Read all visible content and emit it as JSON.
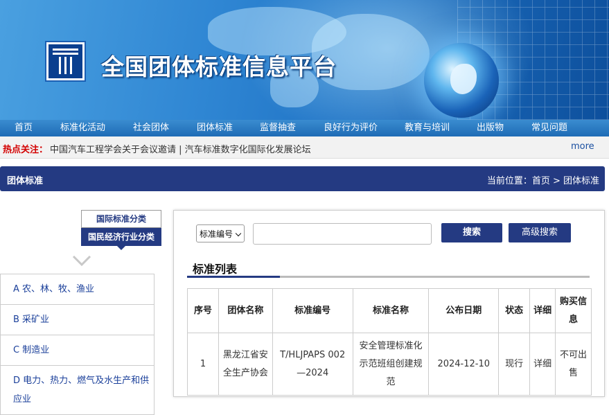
{
  "header": {
    "site_title": "全国团体标准信息平台",
    "logo_icon": "logo-icon"
  },
  "nav": {
    "items": [
      {
        "label": "首页"
      },
      {
        "label": "标准化活动"
      },
      {
        "label": "社会团体"
      },
      {
        "label": "团体标准"
      },
      {
        "label": "监督抽查"
      },
      {
        "label": "良好行为评价"
      },
      {
        "label": "教育与培训"
      },
      {
        "label": "出版物"
      },
      {
        "label": "常见问题"
      }
    ]
  },
  "hotbar": {
    "label": "热点关注：",
    "text": "中国汽车工程学会关于会议邀请 | 汽车标准数字化国际化发展论坛",
    "more": "more"
  },
  "section": {
    "title": "团体标准",
    "breadcrumb": "当前位置：首页 > 团体标准"
  },
  "categories": {
    "tab_international": "国际标准分类",
    "tab_national": "国民经济行业分类",
    "items": [
      {
        "label": "A 农、林、牧、渔业"
      },
      {
        "label": "B 采矿业"
      },
      {
        "label": "C 制造业"
      },
      {
        "label": "D 电力、热力、燃气及水生产和供应业"
      }
    ]
  },
  "search": {
    "field_select": "标准编号",
    "keyword": "",
    "search_label": "搜索",
    "advanced_label": "高级搜索"
  },
  "list": {
    "title": "标准列表",
    "columns": [
      "序号",
      "团体名称",
      "标准编号",
      "标准名称",
      "公布日期",
      "状态",
      "详细",
      "购买信息"
    ],
    "rows": [
      {
        "no": "1",
        "org": "黑龙江省安全生产协会",
        "code": "T/HLJPAPS 002—2024",
        "name": "安全管理标准化示范班组创建规范",
        "date": "2024-12-10",
        "status": "现行",
        "detail": "详细",
        "buy": "不可出售"
      }
    ]
  },
  "colors": {
    "primary": "#243a82",
    "nav": "#1e6bb5",
    "hot": "#d30000",
    "link": "#1a3f9a"
  }
}
